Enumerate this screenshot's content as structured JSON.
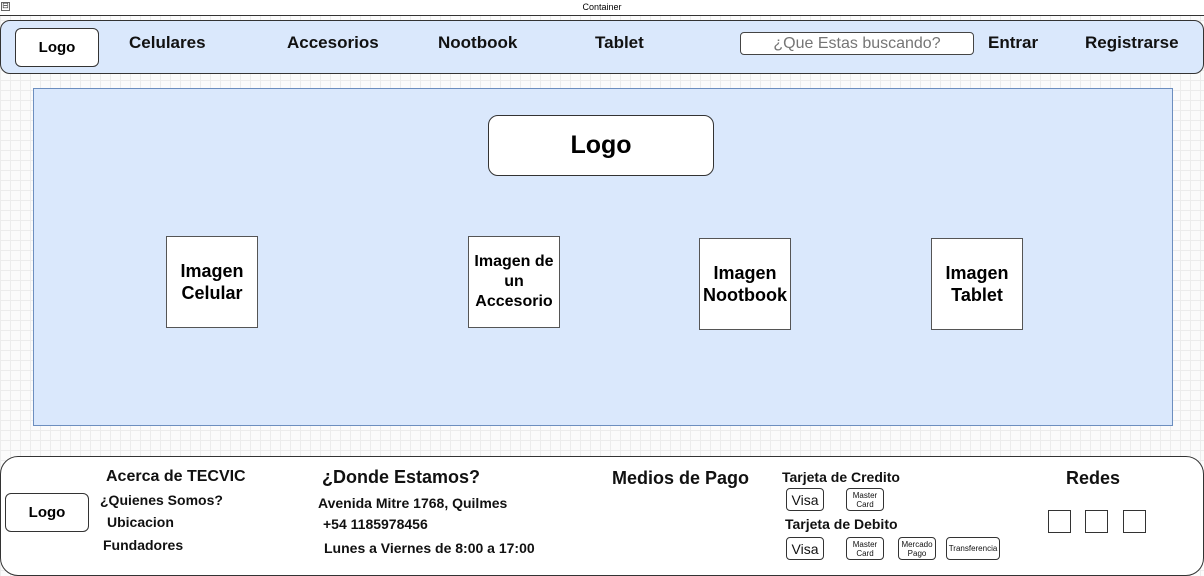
{
  "window": {
    "title": "Container",
    "collapse_glyph": "⊟"
  },
  "header": {
    "logo": "Logo",
    "nav": [
      "Celulares",
      "Accesorios",
      "Nootbook",
      "Tablet"
    ],
    "search_placeholder": "¿Que Estas buscando?",
    "login": "Entrar",
    "register": "Registrarse"
  },
  "hero": {
    "logo": "Logo",
    "images": [
      {
        "lines": [
          "Imagen",
          "Celular"
        ]
      },
      {
        "lines": [
          "Imagen de",
          "un",
          "Accesorio"
        ]
      },
      {
        "lines": [
          "Imagen",
          "Nootbook"
        ]
      },
      {
        "lines": [
          "Imagen",
          "Tablet"
        ]
      }
    ]
  },
  "footer": {
    "logo": "Logo",
    "about": {
      "title": "Acerca de TECVIC",
      "links": [
        "¿Quienes Somos?",
        "Ubicacion",
        "Fundadores"
      ]
    },
    "location": {
      "title": "¿Donde Estamos?",
      "address": "Avenida Mitre 1768, Quilmes",
      "phone": "+54 1185978456",
      "hours": "Lunes a Viernes de 8:00 a 17:00"
    },
    "payment": {
      "title": "Medios de Pago",
      "credit_label": "Tarjeta de Credito",
      "credit_options": [
        "Visa",
        "Master Card"
      ],
      "debit_label": "Tarjeta de Debito",
      "debit_options": [
        "Visa",
        "Master Card",
        "Mercado Pago",
        "Transferencia"
      ]
    },
    "social": {
      "title": "Redes",
      "icons": [
        "social-icon",
        "social-icon",
        "social-icon"
      ]
    }
  }
}
